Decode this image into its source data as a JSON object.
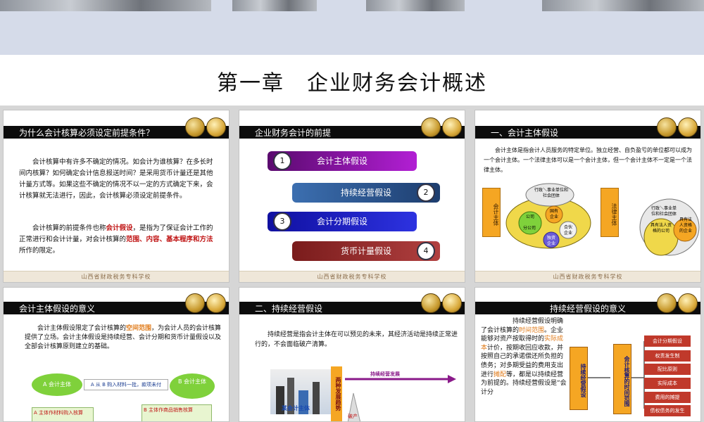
{
  "page_title": "第一章　企业财务会计概述",
  "footer": "山西省财政税务专科学校",
  "slides": [
    {
      "title": "为什么会计核算必须设定前提条件？",
      "p1": "　　会计核算中有许多不确定的情况。如会计为谁核算？在多长时间内核算？如何确定会计信息报送时间？是采用货币计量还是其他计量方式等。如果这些不确定的情况不以一定的方式确定下来，会计核算就无法进行，因此，会计核算必须设定前提条件。",
      "p2a": "　　会计核算的前提条件也称",
      "p2b": "会计假设",
      "p2c": "，是指为了保证会计工作的正常进行和会计计量，对会计核算的",
      "p2d": "范围、内容、基本程序和方法",
      "p2e": "所作的限定。"
    },
    {
      "title": "企业财务会计的前提",
      "items": [
        {
          "num": "1",
          "label": "会计主体假设"
        },
        {
          "num": "2",
          "label": "持续经营假设"
        },
        {
          "num": "3",
          "label": "会计分期假设"
        },
        {
          "num": "4",
          "label": "货币计量假设"
        }
      ]
    },
    {
      "title": "一、会计主体假设",
      "text": "　　会计主体是指会计人员服务的特定单位。独立经营、自负盈亏的单位都可以成为一个会计主体。一个法律主体可以是一个会计主体，但一个会计主体不一定是一个法律主体。",
      "left_label": "会计主体",
      "right_label": "法律主体",
      "bubble_top": "行政＼事业单位和社会团体",
      "bubble_a": "公司",
      "bubble_b": "国有企业",
      "bubble_c": "分公司",
      "bubble_d": "合伙企业",
      "bubble_e": "独资企业",
      "bubble_r1": "行政＼事业单位和社会团体",
      "bubble_r2": "具有法人资格的公司",
      "bubble_r3": "具有法人资格的企业"
    },
    {
      "title": "会计主体假设的意义",
      "t1": "　　会计主体假设限定了会计核算的",
      "t2": "空间范围",
      "t3": "，为会计人员的会计核算提供了立场。会计主体假设是持续经营、会计分期和货币计量假设以及全部会计核算原则建立的基础。",
      "a_label": "A 会计主体",
      "arrow_label": "A 从 B 购入材料一批，款项未付",
      "b_label": "B 会计主体",
      "a_note": "A 主体作材料购入核算",
      "b_note": "B 主体作商品销售核算"
    },
    {
      "title": "二、持续经营假设",
      "text": "　　持续经营是指会计主体在可以预见的未来，其经济活动是持续正常进行的，不会面临破产清算。",
      "arrow_label": "持续经营发展",
      "left_caption": "某会计主体",
      "vertical_label": "两种发展趋势",
      "bottom_label": "破产"
    },
    {
      "title": "持续经营假设的意义",
      "t1": "　　　　　持续经营假设明确了会计核算的",
      "t2": "时间范围",
      "t3": "。企业能够对资产按取得时的",
      "t4": "实际成本",
      "t5": "计价，按期收回应收款，并按照自己的承诺偿还所负担的债务；对多期受益的费用支出进行",
      "t6": "摊配",
      "t7": "等，都是以持续经营为前提的。持续经营假设是“会计分",
      "box1": "持续经营假设",
      "box2": "会计核算的时间范围",
      "right_items": [
        "会计分期假设",
        "权责发生制",
        "配比原则",
        "实际成本",
        "费用的摊提",
        "债权债务的发生"
      ]
    }
  ]
}
